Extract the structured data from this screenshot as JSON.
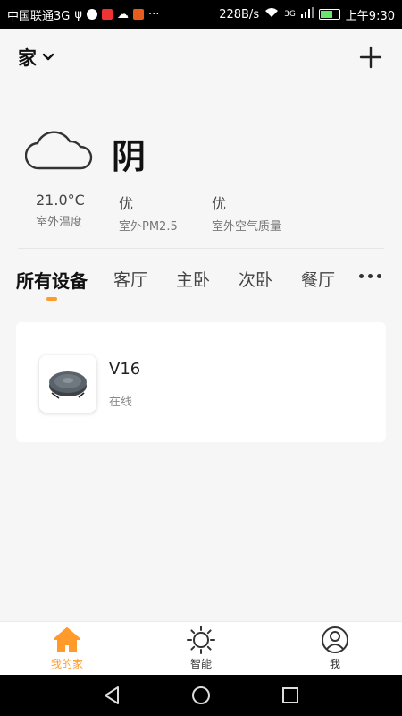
{
  "status_bar": {
    "carrier": "中国联通3G",
    "speed": "228B/s",
    "network": "3G",
    "time": "上午9:30"
  },
  "header": {
    "home_name": "家"
  },
  "weather": {
    "condition": "阴",
    "metrics": [
      {
        "value": "21.0°C",
        "label": "室外温度"
      },
      {
        "value": "优",
        "label": "室外PM2.5"
      },
      {
        "value": "优",
        "label": "室外空气质量"
      }
    ]
  },
  "tabs": [
    {
      "label": "所有设备"
    },
    {
      "label": "客厅"
    },
    {
      "label": "主卧"
    },
    {
      "label": "次卧"
    },
    {
      "label": "餐厅"
    }
  ],
  "devices": [
    {
      "name": "V16",
      "status": "在线",
      "icon": "robot-vacuum-icon"
    }
  ],
  "bottom_nav": [
    {
      "label": "我的家",
      "icon": "home-icon",
      "active": true
    },
    {
      "label": "智能",
      "icon": "sun-icon",
      "active": false
    },
    {
      "label": "我",
      "icon": "user-icon",
      "active": false
    }
  ],
  "colors": {
    "accent": "#ff9a2b",
    "background": "#f6f6f6",
    "card": "#ffffff"
  }
}
